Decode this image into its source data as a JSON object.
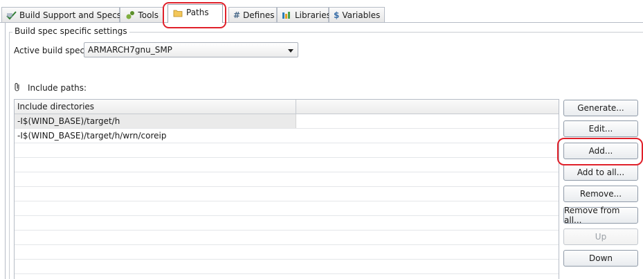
{
  "tabs": [
    {
      "label": "Build Support and Specs",
      "icon": "build-support-icon"
    },
    {
      "label": "Tools",
      "icon": "tools-icon"
    },
    {
      "label": "Paths",
      "icon": "folder-icon",
      "active": true
    },
    {
      "label": "Defines",
      "icon": "hash-icon"
    },
    {
      "label": "Libraries",
      "icon": "libraries-icon"
    },
    {
      "label": "Variables",
      "icon": "dollar-icon"
    }
  ],
  "group": {
    "title": "Build spec specific settings"
  },
  "build_spec": {
    "label": "Active build spec:",
    "value": "ARMARCH7gnu_SMP"
  },
  "include": {
    "label": "Include paths:",
    "column_header": "Include directories",
    "rows": [
      "-I$(WIND_BASE)/target/h",
      "-I$(WIND_BASE)/target/h/wrn/coreip"
    ]
  },
  "buttons": {
    "generate": "Generate...",
    "edit": "Edit...",
    "add": "Add...",
    "add_to_all": "Add to all...",
    "remove": "Remove...",
    "remove_from_all": "Remove from all...",
    "up": "Up",
    "down": "Down"
  },
  "colors": {
    "highlight": "#e0202a",
    "accent": "#2e7d32"
  }
}
